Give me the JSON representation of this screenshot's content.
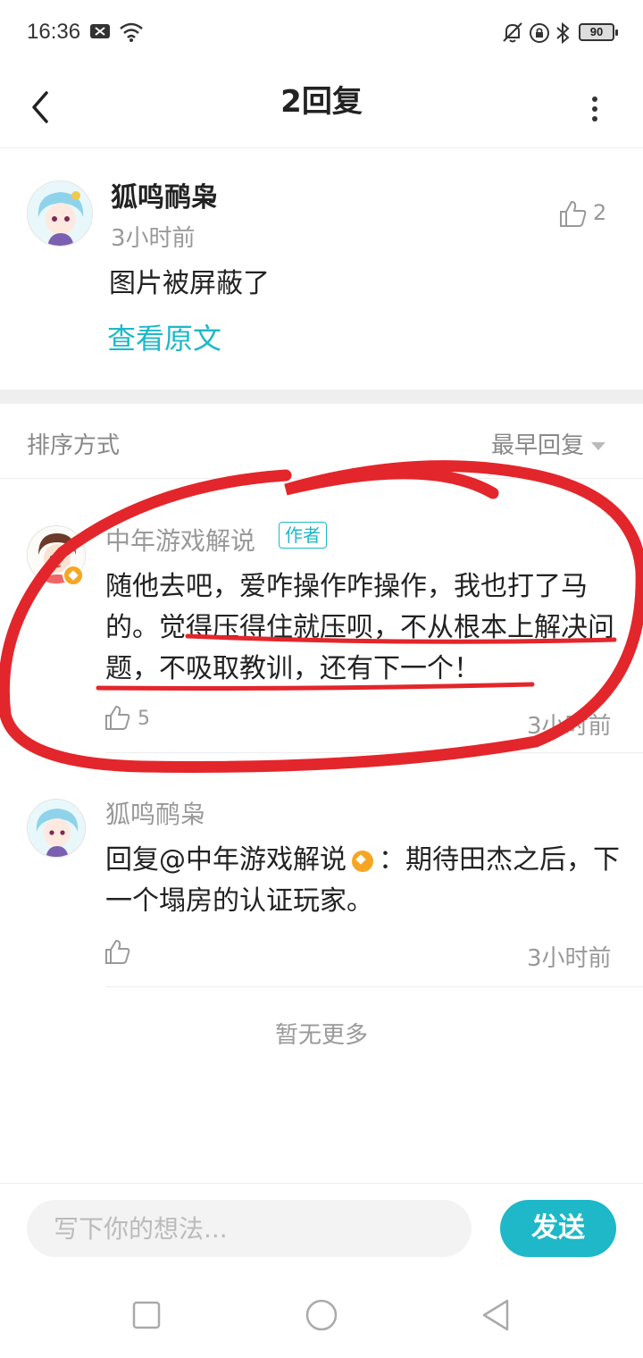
{
  "status_bar": {
    "time": "16:36",
    "battery": "90"
  },
  "header": {
    "title": "2回复"
  },
  "post": {
    "author": "狐鸣鸸枭",
    "time": "3小时前",
    "content": "图片被屏蔽了",
    "view_original": "查看原文",
    "like_count": "2"
  },
  "sort": {
    "label": "排序方式",
    "value": "最早回复"
  },
  "replies": [
    {
      "name": "中年游戏解说",
      "tag": "作者",
      "text": "随他去吧，爱咋操作咋操作，我也打了马的。觉得压得住就压呗，不从根本上解决问题，不吸取教训，还有下一个！",
      "like_count": "5",
      "time": "3小时前"
    },
    {
      "name": "狐鸣鸸枭",
      "reply_prefix": "回复@中年游戏解说",
      "reply_body": "：期待田杰之后，下一个塌房的认证玩家。",
      "time": "3小时前"
    }
  ],
  "no_more": "暂无更多",
  "composer": {
    "placeholder": "写下你的想法...",
    "send_label": "发送"
  },
  "colors": {
    "accent": "#1eb8c8",
    "annotation": "#e3262b",
    "badge": "#f6a623"
  },
  "icons": [
    "back-arrow-icon",
    "more-vertical-icon",
    "thumbs-up-icon",
    "chevron-down-icon",
    "recent-apps-icon",
    "home-icon",
    "back-triangle-icon"
  ]
}
